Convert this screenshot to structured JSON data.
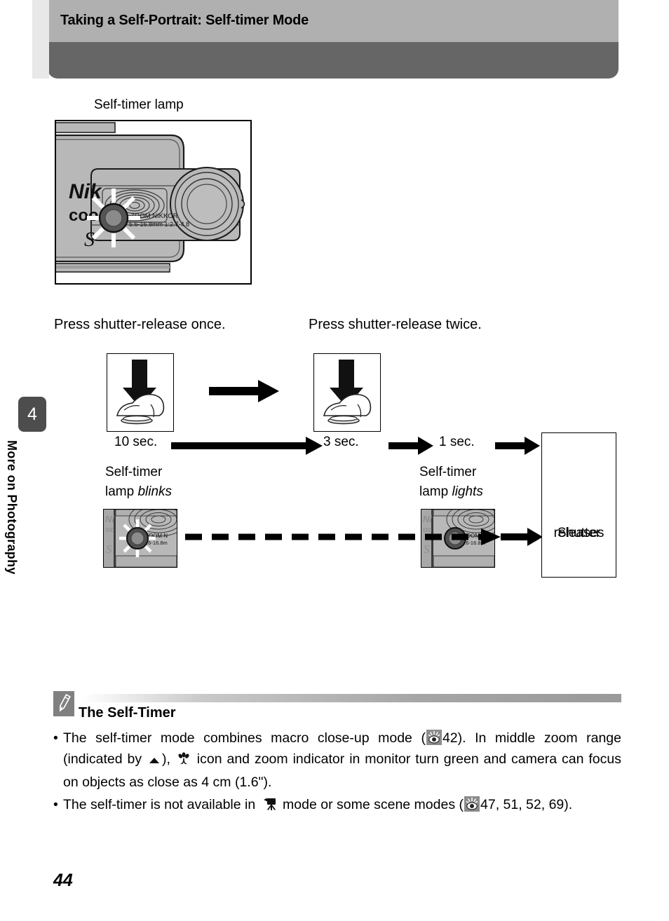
{
  "header": {
    "title": "Taking a Self-Portrait: Self-timer Mode"
  },
  "sidebar": {
    "chapter_number": "4",
    "chapter_label": "More on Photography"
  },
  "illustration": {
    "lamp_caption": "Self-timer lamp",
    "lens_text_line1": "ZOOM NIKKOR",
    "lens_text_line2": "5.6-16.8mm 1:2.7-4.8",
    "brand_line1": "Nik",
    "brand_line2": "coo",
    "brand_line3": "S"
  },
  "flow": {
    "press_once": "Press shutter-release once.",
    "press_twice": "Press shutter-release twice.",
    "time_10": "10 sec.",
    "time_3": "3 sec.",
    "time_1": "1 sec.",
    "lamp_blinks_line1": "Self-timer",
    "lamp_blinks_line2_plain": "lamp ",
    "lamp_blinks_line2_em": "blinks",
    "lamp_lights_line1": "Self-timer",
    "lamp_lights_line2_plain": "lamp ",
    "lamp_lights_line2_em": "lights",
    "shutter_releases_line1": "Shutter",
    "shutter_releases_line2": "releases"
  },
  "note": {
    "icon": "pencil-icon",
    "title": "The Self-Timer",
    "bullet1_part1": "The self-timer mode combines macro close-up mode (",
    "bullet1_ref1": "42",
    "bullet1_part2": "). In middle zoom range (indicated by ",
    "bullet1_part3": "), ",
    "bullet1_part4": " icon and zoom indicator in monitor turn green and camera can focus on objects as close as 4 cm (1.6\").",
    "bullet2_part1": "The self-timer is not available in ",
    "bullet2_part2": " mode or some scene modes (",
    "bullet2_ref1": "47, 51, 52, 69",
    "bullet2_part3": ")."
  },
  "page_number": "44",
  "colors": {
    "header_light": "#b0b0b0",
    "header_dark": "#666666",
    "chapter_tab": "#4d4d4d",
    "ref_badge": "#8c8c8c",
    "camera_body": "#b8b8b8"
  }
}
